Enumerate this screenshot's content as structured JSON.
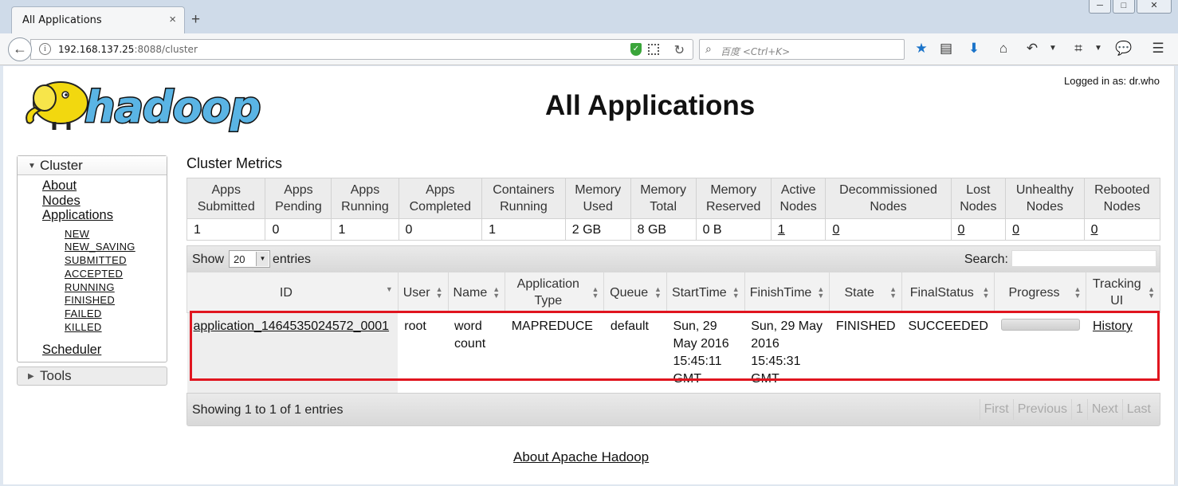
{
  "browser": {
    "tab_title": "All Applications",
    "tab_close": "×",
    "new_tab": "+",
    "url_host": "192.168.137.25",
    "url_path": ":8088/cluster",
    "search_placeholder": "百度 <Ctrl+K>",
    "window_buttons": [
      "─",
      "□",
      "✕"
    ]
  },
  "header": {
    "logged_in": "Logged in as: dr.who",
    "title": "All Applications",
    "logo_text": "hadoop"
  },
  "sidebar": {
    "cluster_label": "Cluster",
    "links": {
      "about": "About",
      "nodes": "Nodes",
      "applications": "Applications",
      "scheduler": "Scheduler"
    },
    "states": [
      "NEW",
      "NEW_SAVING",
      "SUBMITTED",
      "ACCEPTED",
      "RUNNING",
      "FINISHED",
      "FAILED",
      "KILLED"
    ],
    "tools_label": "Tools"
  },
  "metrics": {
    "title": "Cluster Metrics",
    "headers": [
      [
        "Apps",
        "Submitted"
      ],
      [
        "Apps",
        "Pending"
      ],
      [
        "Apps",
        "Running"
      ],
      [
        "Apps",
        "Completed"
      ],
      [
        "Containers",
        "Running"
      ],
      [
        "Memory",
        "Used"
      ],
      [
        "Memory",
        "Total"
      ],
      [
        "Memory",
        "Reserved"
      ],
      [
        "Active",
        "Nodes"
      ],
      [
        "Decommissioned",
        "Nodes"
      ],
      [
        "Lost",
        "Nodes"
      ],
      [
        "Unhealthy",
        "Nodes"
      ],
      [
        "Rebooted",
        "Nodes"
      ]
    ],
    "values": [
      "1",
      "0",
      "1",
      "0",
      "1",
      "2 GB",
      "8 GB",
      "0 B",
      "1",
      "0",
      "0",
      "0",
      "0"
    ]
  },
  "apps_table": {
    "show_label": "Show",
    "page_length": "20",
    "entries_label": "entries",
    "search_label": "Search:",
    "headers": {
      "id": "ID",
      "user": "User",
      "name": "Name",
      "app_type_1": "Application",
      "app_type_2": "Type",
      "queue": "Queue",
      "start": "StartTime",
      "finish": "FinishTime",
      "state": "State",
      "final_status": "FinalStatus",
      "progress": "Progress",
      "tracking_1": "Tracking",
      "tracking_2": "UI"
    },
    "rows": [
      {
        "id": "application_1464535024572_0001",
        "user": "root",
        "name": "word count",
        "type": "MAPREDUCE",
        "queue": "default",
        "start": "Sun, 29 May 2016 15:45:11 GMT",
        "finish": "Sun, 29 May 2016 15:45:31 GMT",
        "state": "FINISHED",
        "final_status": "SUCCEEDED",
        "progress": 1.0,
        "tracking_ui": "History"
      }
    ],
    "info": "Showing 1 to 1 of 1 entries",
    "pager": {
      "first": "First",
      "previous": "Previous",
      "page": "1",
      "next": "Next",
      "last": "Last"
    }
  },
  "footer": {
    "link": "About Apache Hadoop"
  },
  "colors": {
    "highlight": "#e0151f",
    "logo_yellow": "#f2d80f",
    "logo_blue": "#5ab4e4"
  }
}
